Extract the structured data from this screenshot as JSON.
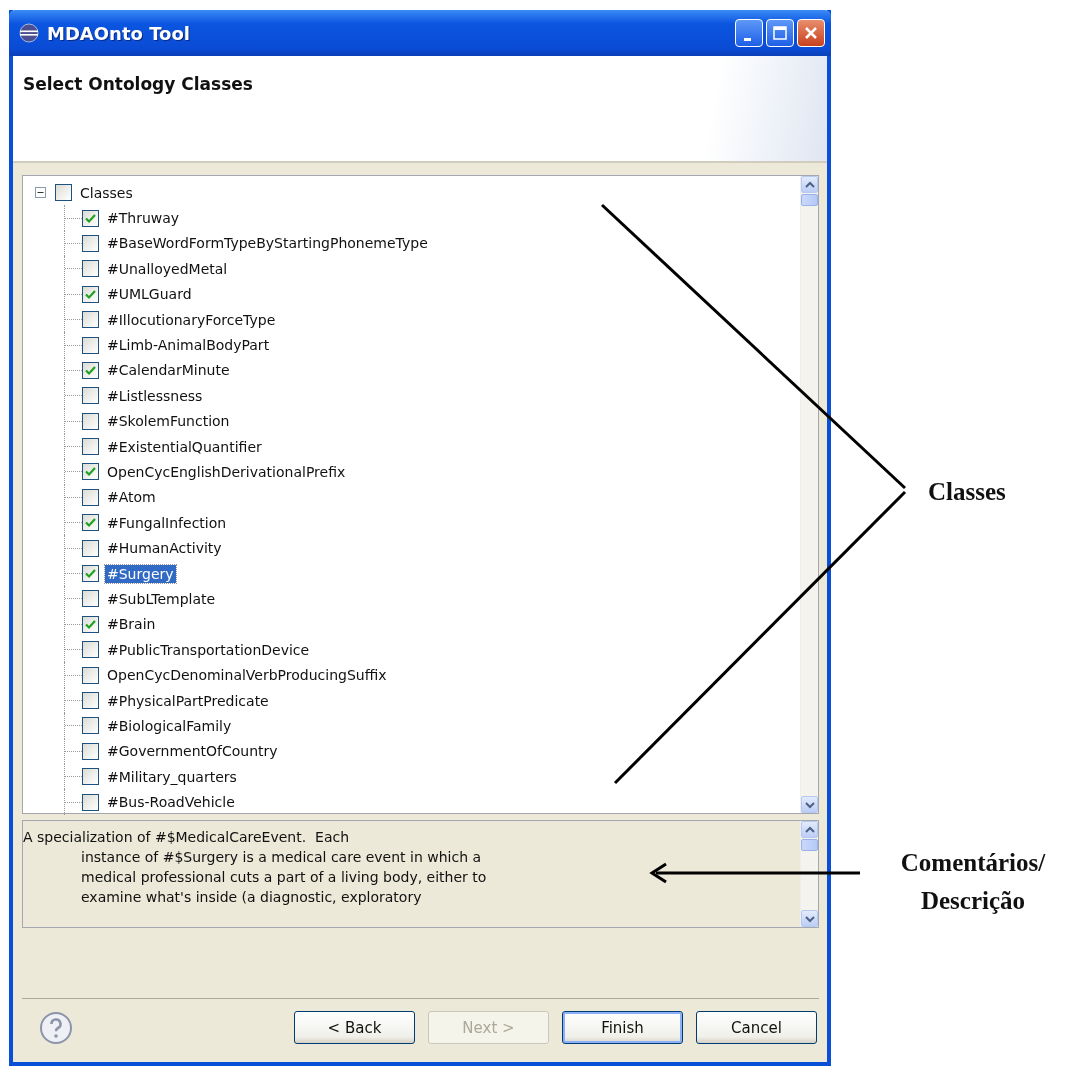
{
  "window": {
    "title": "MDAOnto Tool"
  },
  "header": {
    "title": "Select Ontology Classes"
  },
  "tree": {
    "label": "Classes",
    "expanded": true,
    "checked": false,
    "children": [
      {
        "label": "#Thruway",
        "checked": true,
        "selected": false
      },
      {
        "label": "#BaseWordFormTypeByStartingPhonemeType",
        "checked": false,
        "selected": false
      },
      {
        "label": "#UnalloyedMetal",
        "checked": false,
        "selected": false
      },
      {
        "label": "#UMLGuard",
        "checked": true,
        "selected": false
      },
      {
        "label": "#IllocutionaryForceType",
        "checked": false,
        "selected": false
      },
      {
        "label": "#Limb-AnimalBodyPart",
        "checked": false,
        "selected": false
      },
      {
        "label": "#CalendarMinute",
        "checked": true,
        "selected": false
      },
      {
        "label": "#Listlessness",
        "checked": false,
        "selected": false
      },
      {
        "label": "#SkolemFunction",
        "checked": false,
        "selected": false
      },
      {
        "label": "#ExistentialQuantifier",
        "checked": false,
        "selected": false
      },
      {
        "label": "OpenCycEnglishDerivationalPrefix",
        "checked": true,
        "selected": false
      },
      {
        "label": "#Atom",
        "checked": false,
        "selected": false
      },
      {
        "label": "#FungalInfection",
        "checked": true,
        "selected": false
      },
      {
        "label": "#HumanActivity",
        "checked": false,
        "selected": false
      },
      {
        "label": "#Surgery",
        "checked": true,
        "selected": true
      },
      {
        "label": "#SubLTemplate",
        "checked": false,
        "selected": false
      },
      {
        "label": "#Brain",
        "checked": true,
        "selected": false
      },
      {
        "label": "#PublicTransportationDevice",
        "checked": false,
        "selected": false
      },
      {
        "label": "OpenCycDenominalVerbProducingSuffix",
        "checked": false,
        "selected": false
      },
      {
        "label": "#PhysicalPartPredicate",
        "checked": false,
        "selected": false
      },
      {
        "label": "#BiologicalFamily",
        "checked": false,
        "selected": false
      },
      {
        "label": "#GovernmentOfCountry",
        "checked": false,
        "selected": false
      },
      {
        "label": "#Military_quarters",
        "checked": false,
        "selected": false
      },
      {
        "label": "#Bus-RoadVehicle",
        "checked": false,
        "selected": false
      }
    ]
  },
  "description": {
    "lines": [
      "A specialization of #$MedicalCareEvent.  Each",
      "instance of #$Surgery is a medical care event in which a",
      "medical professional cuts a part of a living body, either to",
      "examine what's inside (a diagnostic, exploratory"
    ]
  },
  "buttons": [
    {
      "label": "< Back",
      "disabled": false,
      "default": false
    },
    {
      "label": "Next >",
      "disabled": true,
      "default": false
    },
    {
      "label": "Finish",
      "disabled": false,
      "default": true
    },
    {
      "label": "Cancel",
      "disabled": false,
      "default": false
    }
  ],
  "annotations": [
    {
      "label": "Classes",
      "kind": "classes"
    },
    {
      "label": "Comentários/ Descrição",
      "kind": "comment"
    }
  ]
}
